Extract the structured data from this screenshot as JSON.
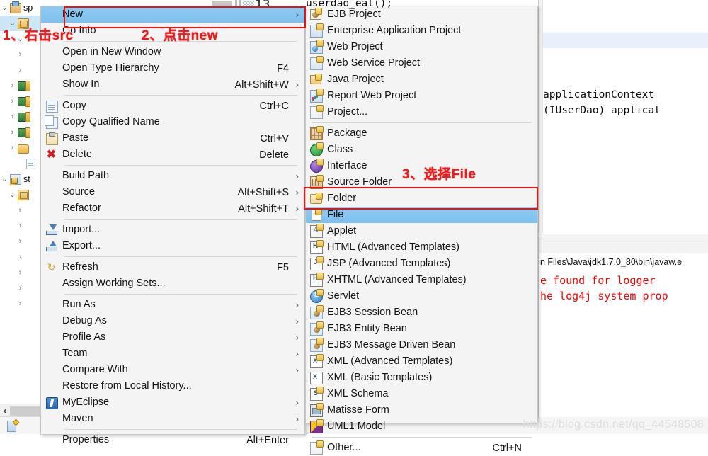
{
  "editor": {
    "top_fragment": "userdao_eat();",
    "line1": "applicationContext",
    "line2": "(IUserDao) applicat",
    "top_number": "13"
  },
  "console": {
    "path_line": "n Files\\Java\\jdk1.7.0_80\\bin\\javaw.e",
    "error_line1": "e found for logger",
    "error_line2": "he log4j system prop"
  },
  "tree": {
    "items": [
      {
        "label": "sp",
        "icon": "project-icon",
        "twisty": "v",
        "indent": 0
      },
      {
        "label": "",
        "icon": "package-icon",
        "twisty": "v",
        "indent": 1
      },
      {
        "label": "",
        "icon": "",
        "twisty": "v",
        "indent": 2
      },
      {
        "label": "",
        "icon": "",
        "twisty": ">",
        "indent": 2
      },
      {
        "label": "",
        "icon": "",
        "twisty": ">",
        "indent": 2
      },
      {
        "label": "",
        "icon": "jar-icon",
        "twisty": ">",
        "indent": 1
      },
      {
        "label": "",
        "icon": "jar-icon",
        "twisty": ">",
        "indent": 1
      },
      {
        "label": "",
        "icon": "jar-icon",
        "twisty": ">",
        "indent": 1
      },
      {
        "label": "",
        "icon": "jar-icon",
        "twisty": ">",
        "indent": 1
      },
      {
        "label": "",
        "icon": "folder-icon",
        "twisty": ">",
        "indent": 1
      },
      {
        "label": "",
        "icon": "file-icon",
        "twisty": "",
        "indent": 2
      },
      {
        "label": "st",
        "icon": "source-folder-icon",
        "twisty": "v",
        "indent": 0
      },
      {
        "label": "",
        "icon": "package-icon",
        "twisty": "v",
        "indent": 1
      },
      {
        "label": "",
        "icon": "",
        "twisty": ">",
        "indent": 2
      },
      {
        "label": "",
        "icon": "",
        "twisty": ">",
        "indent": 2
      },
      {
        "label": "",
        "icon": "",
        "twisty": ">",
        "indent": 2
      },
      {
        "label": "",
        "icon": "",
        "twisty": ">",
        "indent": 2
      },
      {
        "label": "",
        "icon": "",
        "twisty": ">",
        "indent": 2
      },
      {
        "label": "",
        "icon": "",
        "twisty": ">",
        "indent": 2
      },
      {
        "label": "",
        "icon": "",
        "twisty": ">",
        "indent": 2
      }
    ],
    "scroll_left_arrow": "‹"
  },
  "context_menu": {
    "items": [
      {
        "label": "New",
        "accel": "",
        "arrow": true,
        "icon": "",
        "selected": true,
        "sep_after": false
      },
      {
        "label": "Go Into",
        "accel": "",
        "arrow": false,
        "icon": "",
        "selected": false,
        "sep_after": true
      },
      {
        "label": "Open in New Window",
        "accel": "",
        "arrow": false,
        "icon": "",
        "selected": false,
        "sep_after": false
      },
      {
        "label": "Open Type Hierarchy",
        "accel": "F4",
        "arrow": false,
        "icon": "",
        "selected": false,
        "sep_after": false
      },
      {
        "label": "Show In",
        "accel": "Alt+Shift+W",
        "arrow": true,
        "icon": "",
        "selected": false,
        "sep_after": true
      },
      {
        "label": "Copy",
        "accel": "Ctrl+C",
        "arrow": false,
        "icon": "copy-icon",
        "selected": false,
        "sep_after": false
      },
      {
        "label": "Copy Qualified Name",
        "accel": "",
        "arrow": false,
        "icon": "copy-qualified-name-icon",
        "selected": false,
        "sep_after": false
      },
      {
        "label": "Paste",
        "accel": "Ctrl+V",
        "arrow": false,
        "icon": "paste-icon",
        "selected": false,
        "sep_after": false
      },
      {
        "label": "Delete",
        "accel": "Delete",
        "arrow": false,
        "icon": "delete-icon",
        "selected": false,
        "sep_after": true
      },
      {
        "label": "Build Path",
        "accel": "",
        "arrow": true,
        "icon": "",
        "selected": false,
        "sep_after": false
      },
      {
        "label": "Source",
        "accel": "Alt+Shift+S",
        "arrow": true,
        "icon": "",
        "selected": false,
        "sep_after": false
      },
      {
        "label": "Refactor",
        "accel": "Alt+Shift+T",
        "arrow": true,
        "icon": "",
        "selected": false,
        "sep_after": true
      },
      {
        "label": "Import...",
        "accel": "",
        "arrow": false,
        "icon": "import-icon",
        "selected": false,
        "sep_after": false
      },
      {
        "label": "Export...",
        "accel": "",
        "arrow": false,
        "icon": "export-icon",
        "selected": false,
        "sep_after": true
      },
      {
        "label": "Refresh",
        "accel": "F5",
        "arrow": false,
        "icon": "refresh-icon",
        "selected": false,
        "sep_after": false
      },
      {
        "label": "Assign Working Sets...",
        "accel": "",
        "arrow": false,
        "icon": "",
        "selected": false,
        "sep_after": true
      },
      {
        "label": "Run As",
        "accel": "",
        "arrow": true,
        "icon": "",
        "selected": false,
        "sep_after": false
      },
      {
        "label": "Debug As",
        "accel": "",
        "arrow": true,
        "icon": "",
        "selected": false,
        "sep_after": false
      },
      {
        "label": "Profile As",
        "accel": "",
        "arrow": true,
        "icon": "",
        "selected": false,
        "sep_after": false
      },
      {
        "label": "Team",
        "accel": "",
        "arrow": true,
        "icon": "",
        "selected": false,
        "sep_after": false
      },
      {
        "label": "Compare With",
        "accel": "",
        "arrow": true,
        "icon": "",
        "selected": false,
        "sep_after": false
      },
      {
        "label": "Restore from Local History...",
        "accel": "",
        "arrow": false,
        "icon": "",
        "selected": false,
        "sep_after": false
      },
      {
        "label": "MyEclipse",
        "accel": "",
        "arrow": true,
        "icon": "myeclipse-icon",
        "selected": false,
        "sep_after": false
      },
      {
        "label": "Maven",
        "accel": "",
        "arrow": true,
        "icon": "",
        "selected": false,
        "sep_after": true
      },
      {
        "label": "Properties",
        "accel": "Alt+Enter",
        "arrow": false,
        "icon": "",
        "selected": false,
        "sep_after": false
      }
    ]
  },
  "sub_menu": {
    "items": [
      {
        "label": "EJB Project",
        "accel": "",
        "icon": "ejb-project-icon",
        "selected": false,
        "sep_after": false
      },
      {
        "label": "Enterprise Application Project",
        "accel": "",
        "icon": "enterprise-app-icon",
        "selected": false,
        "sep_after": false
      },
      {
        "label": "Web Project",
        "accel": "",
        "icon": "web-project-icon",
        "selected": false,
        "sep_after": false
      },
      {
        "label": "Web Service Project",
        "accel": "",
        "icon": "web-service-icon",
        "selected": false,
        "sep_after": false
      },
      {
        "label": "Java Project",
        "accel": "",
        "icon": "java-project-icon",
        "selected": false,
        "sep_after": false
      },
      {
        "label": "Report Web Project",
        "accel": "",
        "icon": "report-web-icon",
        "selected": false,
        "sep_after": false
      },
      {
        "label": "Project...",
        "accel": "",
        "icon": "project-icon",
        "selected": false,
        "sep_after": true
      },
      {
        "label": "Package",
        "accel": "",
        "icon": "package-icon",
        "selected": false,
        "sep_after": false
      },
      {
        "label": "Class",
        "accel": "",
        "icon": "class-icon",
        "selected": false,
        "sep_after": false
      },
      {
        "label": "Interface",
        "accel": "",
        "icon": "interface-icon",
        "selected": false,
        "sep_after": false
      },
      {
        "label": "Source Folder",
        "accel": "",
        "icon": "source-folder-icon",
        "selected": false,
        "sep_after": false
      },
      {
        "label": "Folder",
        "accel": "",
        "icon": "folder-icon",
        "selected": false,
        "sep_after": false
      },
      {
        "label": "File",
        "accel": "",
        "icon": "file-icon",
        "selected": true,
        "sep_after": false
      },
      {
        "label": "Applet",
        "accel": "",
        "icon": "applet-icon",
        "selected": false,
        "sep_after": false
      },
      {
        "label": "HTML (Advanced Templates)",
        "accel": "",
        "icon": "html-icon",
        "selected": false,
        "sep_after": false
      },
      {
        "label": "JSP (Advanced Templates)",
        "accel": "",
        "icon": "jsp-icon",
        "selected": false,
        "sep_after": false
      },
      {
        "label": "XHTML (Advanced Templates)",
        "accel": "",
        "icon": "xhtml-icon",
        "selected": false,
        "sep_after": false
      },
      {
        "label": "Servlet",
        "accel": "",
        "icon": "servlet-icon",
        "selected": false,
        "sep_after": false
      },
      {
        "label": "EJB3 Session Bean",
        "accel": "",
        "icon": "ejb3-session-bean-icon",
        "selected": false,
        "sep_after": false
      },
      {
        "label": "EJB3 Entity Bean",
        "accel": "",
        "icon": "ejb3-entity-bean-icon",
        "selected": false,
        "sep_after": false
      },
      {
        "label": "EJB3 Message Driven Bean",
        "accel": "",
        "icon": "ejb3-mdb-icon",
        "selected": false,
        "sep_after": false
      },
      {
        "label": "XML (Advanced Templates)",
        "accel": "",
        "icon": "xml-advanced-icon",
        "selected": false,
        "sep_after": false
      },
      {
        "label": "XML (Basic Templates)",
        "accel": "",
        "icon": "xml-basic-icon",
        "selected": false,
        "sep_after": false
      },
      {
        "label": "XML Schema",
        "accel": "",
        "icon": "xml-schema-icon",
        "selected": false,
        "sep_after": false
      },
      {
        "label": "Matisse Form",
        "accel": "",
        "icon": "matisse-form-icon",
        "selected": false,
        "sep_after": false
      },
      {
        "label": "UML1 Model",
        "accel": "",
        "icon": "uml1-model-icon",
        "selected": false,
        "sep_after": true
      },
      {
        "label": "Other...",
        "accel": "Ctrl+N",
        "icon": "other-icon",
        "selected": false,
        "sep_after": false
      }
    ]
  },
  "annotations": {
    "step1": "1、右击src",
    "step2": "2、点击new",
    "step3": "3、选择File"
  },
  "watermark": "https://blog.csdn.net/qq_44548508",
  "colors": {
    "highlight_box": "#ee1111",
    "menu_selection": "#7ec0ee",
    "annotation": "#f11a1a",
    "error_text": "#ff0000"
  }
}
